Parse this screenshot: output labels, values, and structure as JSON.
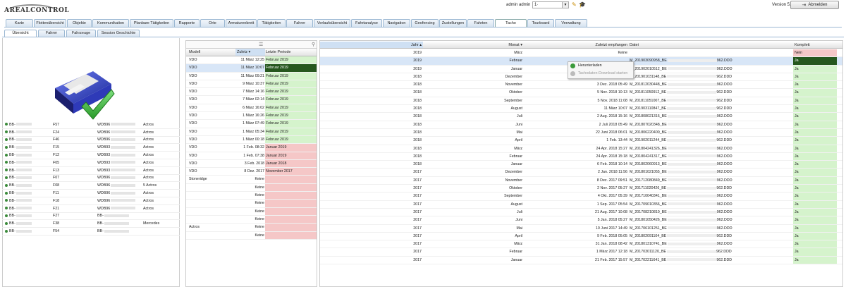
{
  "header": {
    "logo_text": "AREALCONTROL",
    "user_label": "admin admin",
    "user_select_value": "1·",
    "version": "Version 5.8.3",
    "logout_label": "Abmelden"
  },
  "main_tabs": [
    "Karte",
    "Flottenübersicht",
    "Objekte",
    "Kommunikation",
    "Planbare Tätigkeiten",
    "Rapporte",
    "Orte",
    "Armaturenbrett",
    "Tätigkeiten",
    "Fahrer",
    "Verlaufsübersicht",
    "Fahrtanalyse",
    "Navigation",
    "Geofencing",
    "Zustellungen",
    "Fahrten",
    "Tacho",
    "Tourboard",
    "Verwaltung"
  ],
  "active_main_tab": "Tacho",
  "sub_tabs": [
    "Übersicht",
    "Fahrer",
    "Fahrzeuge",
    "Session Geschichte"
  ],
  "active_sub_tab": "Übersicht",
  "vehicles": [
    {
      "plate": "BB-",
      "code": "F57",
      "vin": "WDB96",
      "model": "Actros"
    },
    {
      "plate": "BB-",
      "code": "F24",
      "vin": "WDB96",
      "model": "Actros"
    },
    {
      "plate": "BB-",
      "code": "F46",
      "vin": "WDB96",
      "model": "Actros"
    },
    {
      "plate": "BB-",
      "code": "F15",
      "vin": "WDB93",
      "model": "Actros"
    },
    {
      "plate": "BB-",
      "code": "F12",
      "vin": "WDB93",
      "model": "Actros"
    },
    {
      "plate": "BB-",
      "code": "F05",
      "vin": "WDB93",
      "model": "Actros"
    },
    {
      "plate": "BB-",
      "code": "F13",
      "vin": "WDB93",
      "model": "Actros"
    },
    {
      "plate": "BB-",
      "code": "F07",
      "vin": "WDB96",
      "model": "Actros"
    },
    {
      "plate": "BB-",
      "code": "F08",
      "vin": "WDB96",
      "model": "5 Actros"
    },
    {
      "plate": "BB-",
      "code": "F11",
      "vin": "WDB96",
      "model": "Actros"
    },
    {
      "plate": "BB-",
      "code": "F18",
      "vin": "WDB96",
      "model": "Actros"
    },
    {
      "plate": "BB-",
      "code": "F21",
      "vin": "WDB96",
      "model": "Actros"
    },
    {
      "plate": "BB-",
      "code": "F27",
      "vin": "BB-",
      "model": ""
    },
    {
      "plate": "BB-",
      "code": "F38",
      "vin": "BB-",
      "model": "Mercedes"
    },
    {
      "plate": "BB-",
      "code": "F54",
      "vin": "BB-",
      "model": ""
    }
  ],
  "mid_table": {
    "headers": {
      "model": "Modell",
      "last": "Zuletz",
      "period": "Letzte Periode"
    },
    "rows": [
      {
        "model": "VDO",
        "last": "11 März 12:25",
        "period": "Februar 2019",
        "status": "g"
      },
      {
        "model": "VDO",
        "last": "11 März 10:07",
        "period": "Februar 2019",
        "status": "sel"
      },
      {
        "model": "VDO",
        "last": "11 März 09:21",
        "period": "Februar 2019",
        "status": "g"
      },
      {
        "model": "VDO",
        "last": "9 März 10:37",
        "period": "Februar 2019",
        "status": "g"
      },
      {
        "model": "VDO",
        "last": "7 März 14:16",
        "period": "Februar 2019",
        "status": "g"
      },
      {
        "model": "VDO",
        "last": "7 März 02:14",
        "period": "Februar 2019",
        "status": "g"
      },
      {
        "model": "VDO",
        "last": "6 März 16:02",
        "period": "Februar 2019",
        "status": "g"
      },
      {
        "model": "VDO",
        "last": "1 März 16:26",
        "period": "Februar 2019",
        "status": "g"
      },
      {
        "model": "VDO",
        "last": "1 März 07:49",
        "period": "Februar 2019",
        "status": "g"
      },
      {
        "model": "VDO",
        "last": "1 März 05:34",
        "period": "Februar 2019",
        "status": "g"
      },
      {
        "model": "VDO",
        "last": "1 März 00:18",
        "period": "Februar 2019",
        "status": "g"
      },
      {
        "model": "VDO",
        "last": "1 Feb. 08:32",
        "period": "Januar 2019",
        "status": "r"
      },
      {
        "model": "VDO",
        "last": "1 Feb. 07:38",
        "period": "Januar 2019",
        "status": "r"
      },
      {
        "model": "VDO",
        "last": "3 Feb. 2018",
        "period": "Januar 2018",
        "status": "r"
      },
      {
        "model": "VDO",
        "last": "8 Dez. 2017",
        "period": "November 2017",
        "status": "r"
      },
      {
        "model": "Stoneridge",
        "last": "Keine",
        "period": "",
        "status": "r"
      },
      {
        "model": "",
        "last": "Keine",
        "period": "",
        "status": "r"
      },
      {
        "model": "",
        "last": "Keine",
        "period": "",
        "status": "r"
      },
      {
        "model": "",
        "last": "Keine",
        "period": "",
        "status": "r"
      },
      {
        "model": "",
        "last": "Keine",
        "period": "",
        "status": "r"
      },
      {
        "model": "",
        "last": "Keine",
        "period": "",
        "status": "r"
      },
      {
        "model": "Actros",
        "last": "Keine",
        "period": "",
        "status": "r"
      },
      {
        "model": "",
        "last": "Keine",
        "period": "",
        "status": "r"
      }
    ]
  },
  "right_table": {
    "headers": {
      "year": "Jahr",
      "month": "Monat",
      "received": "Zuletzt empfangen",
      "file": "Datei",
      "complete": "Komplett"
    },
    "rows": [
      {
        "year": "2019",
        "month": "März",
        "received": "Keine",
        "file_pre": "",
        "file_suf": "",
        "complete": "Nein",
        "status": "r"
      },
      {
        "year": "2019",
        "month": "Februar",
        "received": "",
        "file_pre": "M_201903090958_BE",
        "file_suf": "962.DDD",
        "complete": "Ja",
        "status": "sel"
      },
      {
        "year": "2019",
        "month": "Januar",
        "received": "",
        "file_pre": "M_201902010512_BE",
        "file_suf": "962.DDD",
        "complete": "Ja",
        "status": "g"
      },
      {
        "year": "2018",
        "month": "Dezember",
        "received": "3 Jan.",
        "file_pre": "M_201901031148_BE",
        "file_suf": "962.DDD",
        "complete": "Ja",
        "status": "g"
      },
      {
        "year": "2018",
        "month": "November",
        "received": "3 Dez. 2018 05:49",
        "file_pre": "M_201812030448_BE",
        "file_suf": "962.DDD",
        "complete": "Ja",
        "status": "g"
      },
      {
        "year": "2018",
        "month": "Oktober",
        "received": "5 Nov. 2018 10:13",
        "file_pre": "M_201811050912_BE",
        "file_suf": "962.DDD",
        "complete": "Ja",
        "status": "g"
      },
      {
        "year": "2018",
        "month": "September",
        "received": "5 Nov. 2018 11:08",
        "file_pre": "M_201811051007_BE",
        "file_suf": "962.DDD",
        "complete": "Ja",
        "status": "g"
      },
      {
        "year": "2018",
        "month": "August",
        "received": "11 März 10:07",
        "file_pre": "M_201903110847_BE",
        "file_suf": "962.DDD",
        "complete": "Ja",
        "status": "g"
      },
      {
        "year": "2018",
        "month": "Juli",
        "received": "2 Aug. 2018 15:16",
        "file_pre": "M_201808021316_BE",
        "file_suf": "962.DDD",
        "complete": "Ja",
        "status": "g"
      },
      {
        "year": "2018",
        "month": "Juni",
        "received": "2 Juli 2018 05:49",
        "file_pre": "M_201807020348_BE",
        "file_suf": "962.DDD",
        "complete": "Ja",
        "status": "g"
      },
      {
        "year": "2018",
        "month": "Mai",
        "received": "22 Juni 2018 06:01",
        "file_pre": "M_201806220400_BE",
        "file_suf": "962.DDD",
        "complete": "Ja",
        "status": "g"
      },
      {
        "year": "2018",
        "month": "April",
        "received": "1 Feb. 13:44",
        "file_pre": "M_201902011244_BE",
        "file_suf": "962.DDD",
        "complete": "Ja",
        "status": "g"
      },
      {
        "year": "2018",
        "month": "März",
        "received": "24 Apr. 2018 15:27",
        "file_pre": "M_201804241326_BE",
        "file_suf": "962.DDD",
        "complete": "Ja",
        "status": "g"
      },
      {
        "year": "2018",
        "month": "Februar",
        "received": "24 Apr. 2018 15:18",
        "file_pre": "M_201804241317_BE",
        "file_suf": "962.DDD",
        "complete": "Ja",
        "status": "g"
      },
      {
        "year": "2018",
        "month": "Januar",
        "received": "6 Feb. 2018 10:14",
        "file_pre": "M_201802060913_BE",
        "file_suf": "962.DDD",
        "complete": "Ja",
        "status": "g"
      },
      {
        "year": "2017",
        "month": "Dezember",
        "received": "2 Jan. 2018 11:56",
        "file_pre": "M_201801021055_BE",
        "file_suf": "962.DDD",
        "complete": "Ja",
        "status": "g"
      },
      {
        "year": "2017",
        "month": "November",
        "received": "8 Dez. 2017 09:51",
        "file_pre": "M_201712080849_BE",
        "file_suf": "962.DDD",
        "complete": "Ja",
        "status": "g"
      },
      {
        "year": "2017",
        "month": "Oktober",
        "received": "2 Nov. 2017 05:27",
        "file_pre": "M_201711020426_BE",
        "file_suf": "962.DDD",
        "complete": "Ja",
        "status": "g"
      },
      {
        "year": "2017",
        "month": "September",
        "received": "4 Okt. 2017 05:39",
        "file_pre": "M_201710040341_BE",
        "file_suf": "962.DDD",
        "complete": "Ja",
        "status": "g"
      },
      {
        "year": "2017",
        "month": "August",
        "received": "1 Sep. 2017 05:54",
        "file_pre": "M_201709010356_BE",
        "file_suf": "962.DDD",
        "complete": "Ja",
        "status": "g"
      },
      {
        "year": "2017",
        "month": "Juli",
        "received": "21 Aug. 2017 10:08",
        "file_pre": "M_201708210810_BE",
        "file_suf": "962.DDD",
        "complete": "Ja",
        "status": "g"
      },
      {
        "year": "2017",
        "month": "Juni",
        "received": "5 Jan. 2018 05:27",
        "file_pre": "M_201801050426_BE",
        "file_suf": "962.DDD",
        "complete": "Ja",
        "status": "g"
      },
      {
        "year": "2017",
        "month": "Mai",
        "received": "10 Juni 2017 14:49",
        "file_pre": "M_201706101251_BE",
        "file_suf": "962.DDD",
        "complete": "Ja",
        "status": "g"
      },
      {
        "year": "2017",
        "month": "April",
        "received": "9 Feb. 2018 05:05",
        "file_pre": "M_201802091104_BE",
        "file_suf": "962.DDD",
        "complete": "Ja",
        "status": "g"
      },
      {
        "year": "2017",
        "month": "März",
        "received": "31 Jan. 2018 08:42",
        "file_pre": "M_201801310741_BE",
        "file_suf": "962.DDD",
        "complete": "Ja",
        "status": "g"
      },
      {
        "year": "2017",
        "month": "Februar",
        "received": "1 März 2017 12:18",
        "file_pre": "M_201703011120_BE",
        "file_suf": "962.DDD",
        "complete": "Ja",
        "status": "g"
      },
      {
        "year": "2017",
        "month": "Januar",
        "received": "21 Feb. 2017 15:57",
        "file_pre": "M_201702211641_BE",
        "file_suf": "962.DDD",
        "complete": "Ja",
        "status": "g"
      }
    ]
  },
  "context_menu": {
    "download": "Herunterladen",
    "start": "Tachodaten-Download starten"
  }
}
